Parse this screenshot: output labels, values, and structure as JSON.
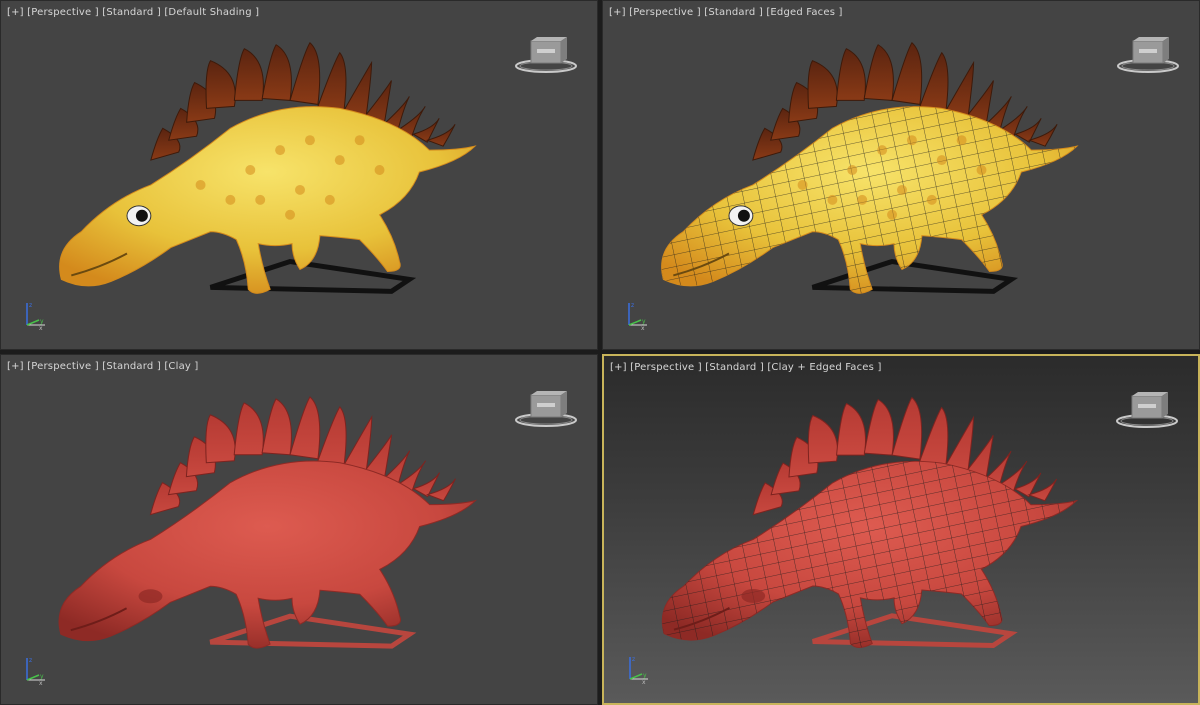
{
  "viewports": [
    {
      "bracket_plus": "[+]",
      "view": "[Perspective ]",
      "preset": "[Standard ]",
      "shading": "[Default Shading ]",
      "material": "yellow",
      "wireframe": false,
      "active": false
    },
    {
      "bracket_plus": "[+]",
      "view": "[Perspective ]",
      "preset": "[Standard ]",
      "shading": "[Edged Faces ]",
      "material": "yellow",
      "wireframe": true,
      "active": false
    },
    {
      "bracket_plus": "[+]",
      "view": "[Perspective ]",
      "preset": "[Standard ]",
      "shading": "[Clay ]",
      "material": "clay",
      "wireframe": false,
      "active": false
    },
    {
      "bracket_plus": "[+]",
      "view": "[Perspective ]",
      "preset": "[Standard ]",
      "shading": "[Clay + Edged Faces ]",
      "material": "clay",
      "wireframe": true,
      "active": true
    }
  ],
  "colors": {
    "viewport_bg": "#444444",
    "active_border": "#c8b45a",
    "label_text": "#d6d6d6",
    "yellow_body": "#e8c23a",
    "yellow_spots": "#d48a1c",
    "plates_brown": "#8a3a16",
    "clay_body": "#c8483f",
    "clay_dark": "#8e2a25",
    "wire": "#1a1a1a"
  },
  "icons": {
    "viewcube": "viewcube-icon",
    "axis": "axis-tripod-icon",
    "model": "stegosaurus-model"
  }
}
